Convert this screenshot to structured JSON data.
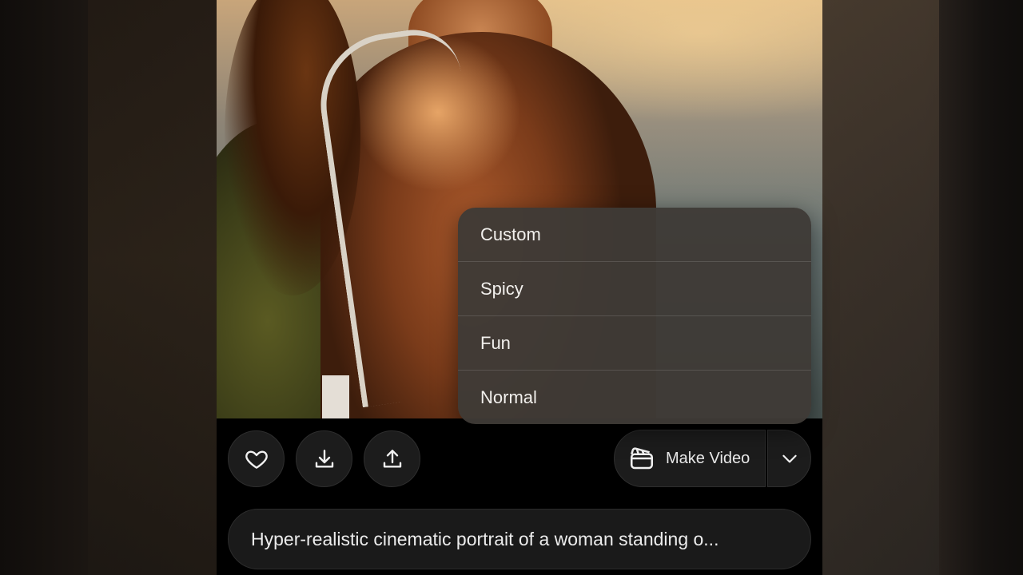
{
  "menu": {
    "items": [
      {
        "label": "Custom"
      },
      {
        "label": "Spicy"
      },
      {
        "label": "Fun"
      },
      {
        "label": "Normal"
      }
    ]
  },
  "actions": {
    "like_icon": "heart-icon",
    "download_icon": "download-icon",
    "share_icon": "share-icon",
    "make_video_label": "Make Video",
    "make_video_icon": "clapperboard-icon",
    "options_icon": "chevron-down-icon"
  },
  "prompt": {
    "text": "Hyper-realistic cinematic portrait of a woman standing o..."
  },
  "colors": {
    "background": "#000000",
    "button_bg": "#1c1c1c",
    "menu_bg": "#3e3a36",
    "text": "#f2f0ed"
  }
}
